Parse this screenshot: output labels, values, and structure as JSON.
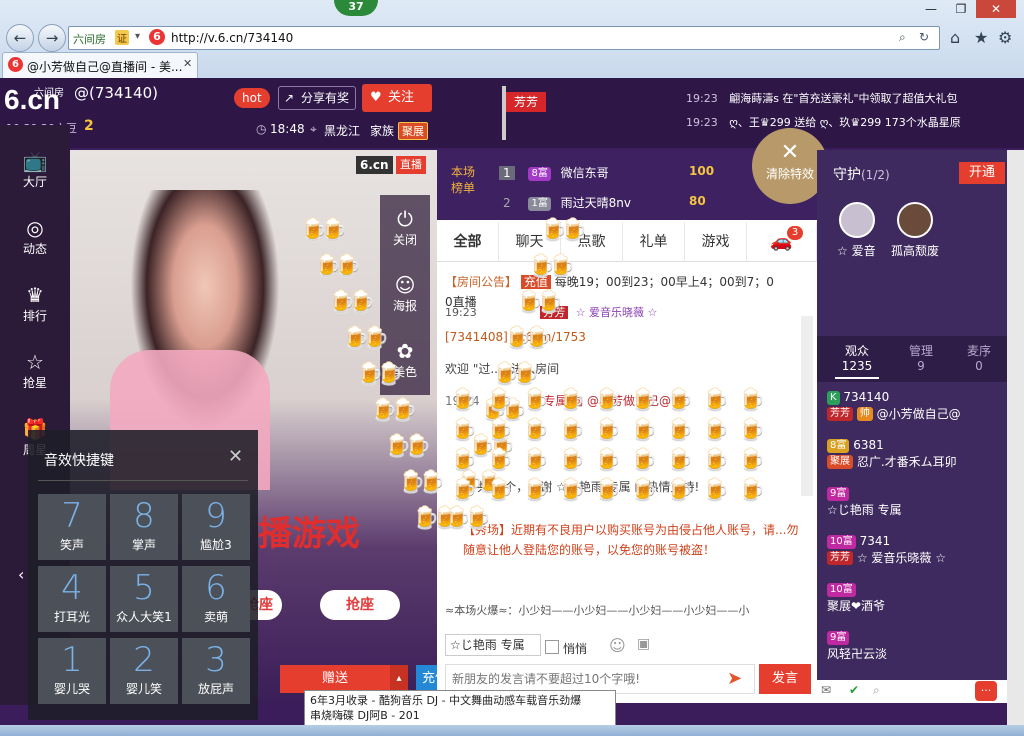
{
  "browser": {
    "badge_count": "37",
    "site_label": "六间房",
    "site_badge": "证",
    "url": "http://v.6.cn/734140",
    "tab_title": "@小芳做自己@直播间 - 美...",
    "window_buttons": [
      "—",
      "❐",
      "✕"
    ]
  },
  "header": {
    "logo": "6.cn",
    "logo_sub": "六间房",
    "room_title": "@(734140)",
    "hot_label": "hot",
    "share_label": "分享有奖",
    "follow_label": "关注",
    "time": "18:48",
    "location": "黑龙江",
    "family_label": "家族",
    "family_badge": "聚展",
    "flag_name": "芳芳",
    "coins": "10·39.20六豆",
    "level": "2"
  },
  "ticker": [
    {
      "time": "19:23",
      "text": "翩海蒔濤s 在\"首充送豪礼\"中领取了超值大礼包"
    },
    {
      "time": "19:23",
      "text": "ღ、王♛299 送给 ღ、玖♛299 173个水晶星原"
    }
  ],
  "leftnav": [
    {
      "label": "大厅",
      "icon": "tv-icon"
    },
    {
      "label": "动态",
      "icon": "compass-icon"
    },
    {
      "label": "排行",
      "icon": "crown-icon"
    },
    {
      "label": "抢星",
      "icon": "star-icon"
    },
    {
      "label": "周星",
      "icon": "gift-icon"
    }
  ],
  "video": {
    "watermark": "6.cn",
    "live_badge": "直播",
    "banner_text": "播游戏",
    "grab_seat": "抢座",
    "grab_seat2": "抢座",
    "side_buttons": [
      {
        "label": "关闭",
        "icon": "power-icon"
      },
      {
        "label": "海报",
        "icon": "smile-icon"
      },
      {
        "label": "美色",
        "icon": "effect-icon"
      }
    ]
  },
  "keypad": {
    "title": "音效快捷键",
    "keys": [
      {
        "n": "7",
        "label": "笑声"
      },
      {
        "n": "8",
        "label": "掌声"
      },
      {
        "n": "9",
        "label": "尴尬3"
      },
      {
        "n": "4",
        "label": "打耳光"
      },
      {
        "n": "5",
        "label": "众人大笑1"
      },
      {
        "n": "6",
        "label": "卖萌"
      },
      {
        "n": "1",
        "label": "婴儿哭"
      },
      {
        "n": "2",
        "label": "婴儿笑"
      },
      {
        "n": "3",
        "label": "放屁声"
      }
    ]
  },
  "rank": {
    "title1": "本场",
    "title2": "榜单",
    "rows": [
      {
        "pos": "1",
        "badge": "8富",
        "name": "微信东哥",
        "value": "100"
      },
      {
        "pos": "2",
        "badge": "1富",
        "name": "雨过天晴8nv",
        "value": "80"
      }
    ],
    "clear_effect": "清除特效",
    "car_count": "3"
  },
  "chat_tabs": [
    "全部",
    "聊天",
    "点歌",
    "礼单",
    "游戏"
  ],
  "chat": {
    "notice_label": "【房间公告】",
    "notice_badge": "充值",
    "notice_text": "每晚19；00到23；00早上4；00到7；0",
    "notice_text2": "0直播",
    "line1_time": "19:23",
    "line1_user1": "芳芳",
    "line1_user2": "☆ 爱音乐晓薇 ☆",
    "line2": "[7341408] /v.6.cn/1753",
    "welcome": "欢迎 \"过...\" 进入房间",
    "line3_time": "19:24",
    "line3_text": "专属 向 @小芳做自己@ 送",
    "gift_text": "共50个，感谢 ☆じ艳雨 专属 的热情支持!",
    "warning": "【秀场】近期有不良用户以购买账号为由侵占他人账号，请...勿随意让他人登陆您的账号，以免您的账号被盗！",
    "hot_row": "≈本场火爆≈：小少妇——小少妇——小少妇——小少妇——小",
    "input_user": "☆じ艳雨 专属",
    "whisper": "悄悄",
    "input_placeholder": "新朋友的发言请不要超过10个字哦!",
    "send_label": "发言",
    "gift_send": "赠送",
    "recharge": "充值"
  },
  "right": {
    "guard_label": "守护",
    "guard_count": "(1/2)",
    "open_btn": "开通",
    "guards": [
      {
        "name": "☆ 爱音"
      },
      {
        "name": "孤高颓废"
      }
    ],
    "tabs": [
      {
        "label": "观众",
        "count": "1235"
      },
      {
        "label": "管理",
        "count": "9"
      },
      {
        "label": "麦序",
        "count": "0"
      }
    ],
    "users": [
      {
        "id": "734140",
        "badge": "K",
        "name": "@小芳做自己@",
        "tag": "芳芳",
        "role": "帅"
      },
      {
        "id": "6381",
        "badge": "聚展",
        "name": "忍广.才番禾ム耳卯",
        "lvl": "8富"
      },
      {
        "lvl": "9富",
        "name": "☆じ艳雨 专属"
      },
      {
        "lvl": "10富",
        "id": "7341",
        "tag": "芳芳",
        "name": "☆ 爱音乐晓薇 ☆"
      },
      {
        "lvl": "10富",
        "name": "聚展❤酒爷"
      },
      {
        "lvl": "9富",
        "name": "风轻卍云淡"
      }
    ]
  },
  "tooltip": {
    "line1": "6年3月收录 - 酷狗音乐 DJ - 中文舞曲动感车载音乐劲爆",
    "line2": "串烧嗨碟 DJ阿B - 201"
  }
}
